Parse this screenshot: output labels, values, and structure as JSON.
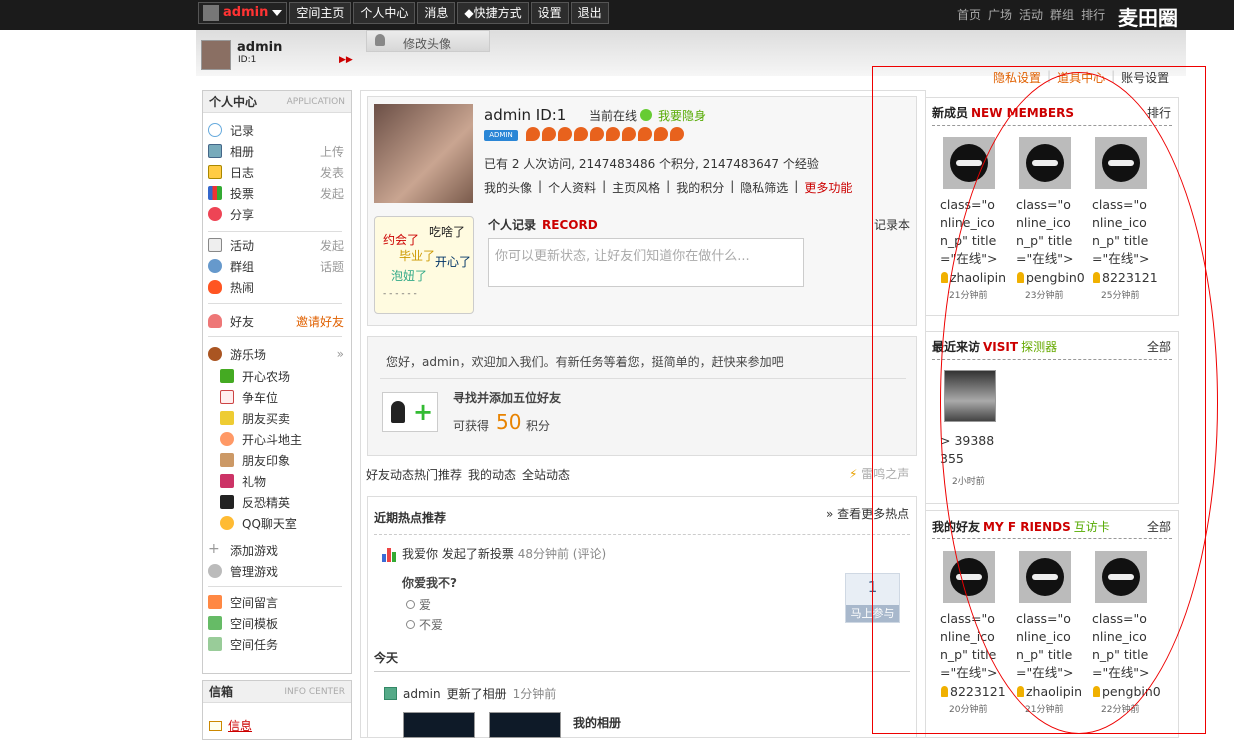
{
  "topbar": {
    "user": "admin",
    "nav": [
      "空间主页",
      "个人中心",
      "消息",
      "◆快捷方式",
      "设置",
      "退出"
    ],
    "right_nav": [
      "首页",
      "广场",
      "活动",
      "群组",
      "排行"
    ],
    "logo": "麦田圈"
  },
  "header": {
    "name": "admin",
    "id": "ID:1",
    "tab_label": "修改头像"
  },
  "top_links": {
    "privacy": "隐私设置",
    "props": "道具中心",
    "account": "账号设置"
  },
  "left": {
    "title": "个人中心",
    "subtitle": "APPLICATION",
    "items": [
      {
        "label": "记录",
        "sub": ""
      },
      {
        "label": "相册",
        "sub": "上传"
      },
      {
        "label": "日志",
        "sub": "发表"
      },
      {
        "label": "投票",
        "sub": "发起"
      },
      {
        "label": "分享",
        "sub": ""
      },
      {
        "label": "活动",
        "sub": "发起"
      },
      {
        "label": "群组",
        "sub": "话题"
      },
      {
        "label": "热闹",
        "sub": ""
      },
      {
        "label": "好友",
        "sub": "邀请好友"
      },
      {
        "label": "游乐场",
        "sub": "»"
      }
    ],
    "games": [
      "开心农场",
      "争车位",
      "朋友买卖",
      "开心斗地主",
      "朋友印象",
      "礼物",
      "反恐精英",
      "QQ聊天室"
    ],
    "extras": [
      "添加游戏",
      "管理游戏",
      "空间留言",
      "空间模板",
      "空间任务"
    ],
    "info_title": "信箱",
    "info_subtitle": "INFO CENTER",
    "info_item": "信息"
  },
  "profile": {
    "name": "admin  ID:1",
    "online": "当前在线",
    "invisible": "我要隐身",
    "badge": "ADMIN",
    "stats": "已有 2 人次访问, 2147483486 个积分, 2147483647 个经验",
    "links": [
      "我的头像",
      "|",
      "个人资料",
      "|",
      "主页风格",
      "|",
      "我的积分",
      "|",
      "隐私筛选",
      "|",
      "更多功能"
    ],
    "card": [
      "约会了",
      "吃啥了",
      "毕业了",
      "开心了",
      "泡妞了",
      "- - - - - -"
    ],
    "record_title": "个人记录",
    "record_en": "RECORD",
    "record_book": "记录本",
    "record_placeholder": "你可以更新状态, 让好友们知道你在做什么..."
  },
  "task": {
    "hello": "您好，admin，欢迎加入我们。有新任务等着您，挺简单的，赶快来参加吧",
    "title": "寻找并添加五位好友",
    "gain": "可获得",
    "points": "50",
    "unit": "积分"
  },
  "feed": {
    "tabs": [
      "好友动态热门推荐",
      "我的动态",
      "全站动态"
    ],
    "thunder": "雷鸣之声",
    "hot_title": "近期热点推荐",
    "hot_more": "» 查看更多热点",
    "vote_user": "我爱你",
    "vote_action": "发起了新投票",
    "vote_time": "48分钟前 (评论)",
    "vote_question": "你爱我不?",
    "vote_options": [
      "爱",
      "不爱"
    ],
    "vote_count": "1",
    "vote_button": "马上参与",
    "today": "今天",
    "act_user": "admin",
    "act_action": "更新了相册",
    "act_time": "1分钟前",
    "album": "我的相册"
  },
  "right": {
    "new_title": "新成员",
    "new_en": "NEW MEMBERS",
    "new_side": "排行",
    "new_members": [
      {
        "text": "class=\"online_icon_p\" title=\"在线\">",
        "name": "zhaolipin",
        "time": "21分钟前"
      },
      {
        "text": "class=\"online_icon_p\" title=\"在线\">",
        "name": "pengbin0",
        "time": "23分钟前"
      },
      {
        "text": "class=\"online_icon_p\" title=\"在线\">",
        "name": "8223121",
        "time": "25分钟前"
      }
    ],
    "visit_title": "最近来访",
    "visit_en": "VISIT",
    "visit_extra": "探测器",
    "visit_side": "全部",
    "visitor_text": "> 39388355",
    "visitor_time": "2小时前",
    "friends_title": "我的好友",
    "friends_en": "MY F RIENDS",
    "friends_extra": "互访卡",
    "friends_side": "全部",
    "friends": [
      {
        "text": "class=\"online_icon_p\" title=\"在线\">",
        "name": "8223121",
        "time": "20分钟前"
      },
      {
        "text": "class=\"online_icon_p\" title=\"在线\">",
        "name": "zhaolipin",
        "time": "21分钟前"
      },
      {
        "text": "class=\"online_icon_p\" title=\"在线\">",
        "name": "pengbin0",
        "time": "22分钟前"
      }
    ]
  }
}
